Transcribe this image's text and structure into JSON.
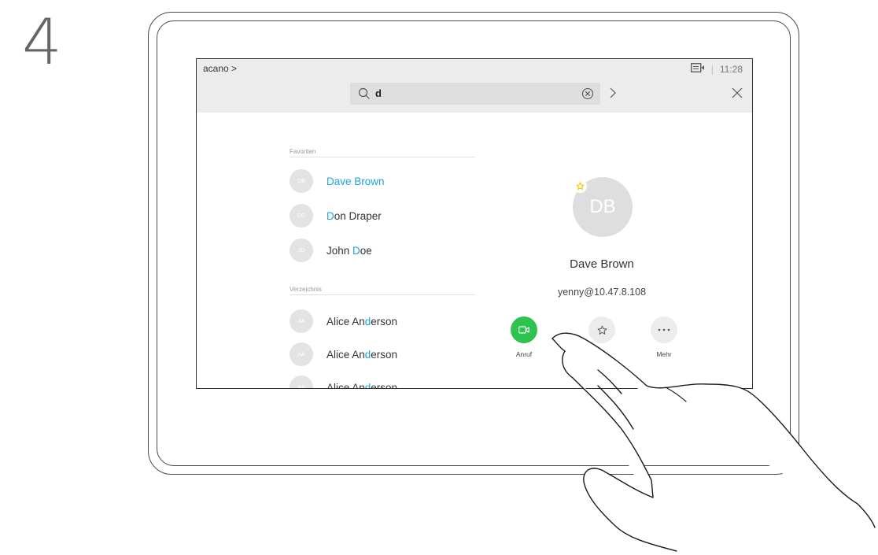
{
  "step": "4",
  "topbar": {
    "breadcrumb": "acano >",
    "time": "11:28",
    "separator": "|",
    "search_value": "d"
  },
  "favorites": {
    "header": "Favoriten",
    "contacts": [
      {
        "initials": "DB",
        "pre": "",
        "hl": "Dave Brown",
        "post": ""
      },
      {
        "initials": "DD",
        "pre": "",
        "hl": "D",
        "post": "on Draper"
      },
      {
        "initials": "JD",
        "pre": "John ",
        "hl": "D",
        "post": "oe"
      }
    ]
  },
  "directory": {
    "header": "Verzeichnis",
    "contacts": [
      {
        "initials": "AA",
        "pre": "Alice An",
        "hl": "d",
        "post": "erson"
      },
      {
        "initials": "AA",
        "pre": "Alice An",
        "hl": "d",
        "post": "erson"
      },
      {
        "initials": "AA",
        "pre": "Alice An",
        "hl": "d",
        "post": "erson"
      }
    ]
  },
  "detail": {
    "initials": "DB",
    "name": "Dave Brown",
    "address": "yenny@10.47.8.108",
    "actions": [
      {
        "label": "Anruf",
        "icon": "video-camera-icon"
      },
      {
        "label": "",
        "icon": "star-icon"
      },
      {
        "label": "Mehr",
        "icon": "more-dots-icon"
      }
    ]
  },
  "colors": {
    "highlight": "#1fa3d9",
    "call_green": "#2ec24f",
    "favorite_star": "#f3c300"
  }
}
